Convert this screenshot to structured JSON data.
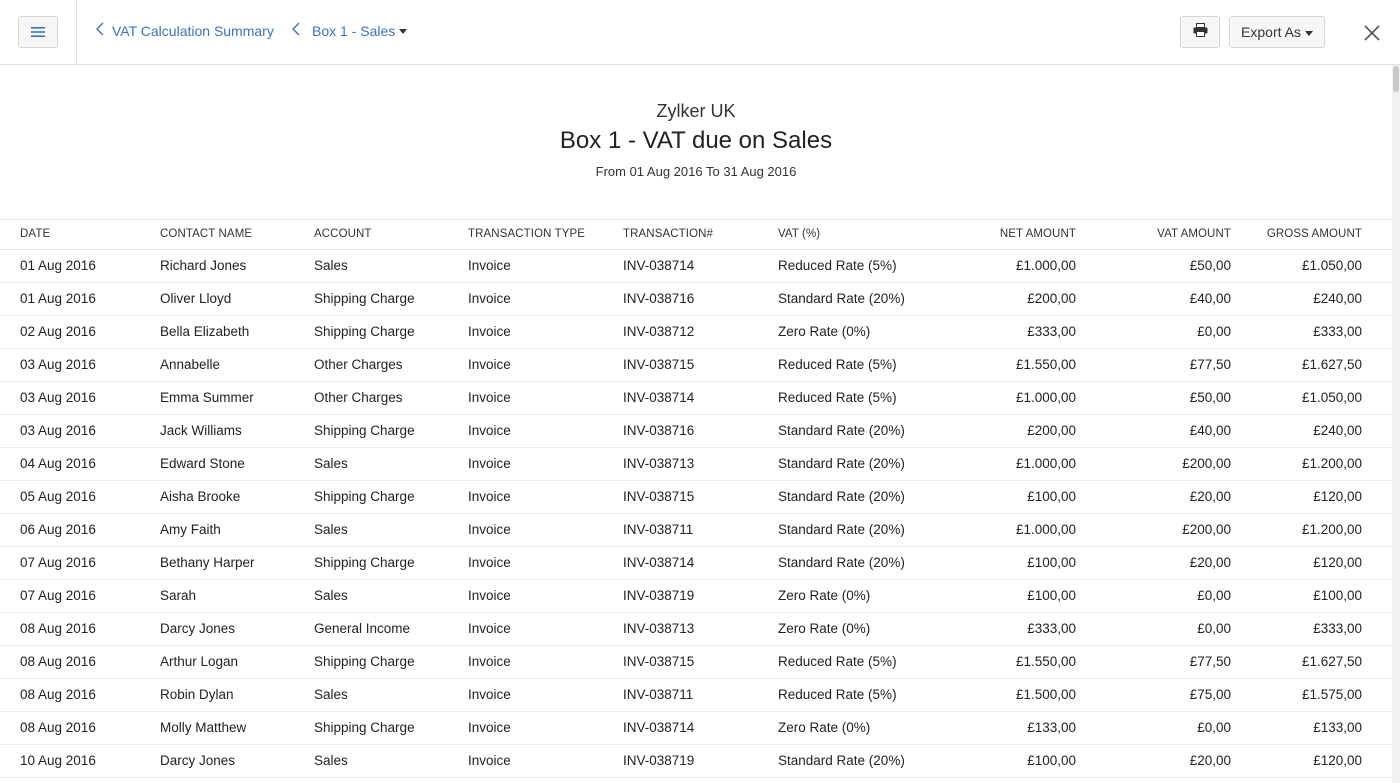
{
  "header": {
    "breadcrumb_parent": "VAT Calculation Summary",
    "breadcrumb_current": "Box 1 - Sales",
    "export_label": "Export As",
    "icons": [
      "menu-icon",
      "chevron-left-icon",
      "caret-down-icon",
      "printer-icon",
      "close-icon"
    ]
  },
  "report": {
    "organization": "Zylker UK",
    "title": "Box 1 - VAT due on Sales",
    "date_range": "From 01 Aug 2016 To 31 Aug 2016"
  },
  "table": {
    "columns": [
      "DATE",
      "CONTACT NAME",
      "ACCOUNT",
      "TRANSACTION TYPE",
      "TRANSACTION#",
      "VAT (%)",
      "NET AMOUNT",
      "VAT AMOUNT",
      "GROSS AMOUNT"
    ],
    "rows": [
      [
        "01 Aug 2016",
        "Richard Jones",
        "Sales",
        "Invoice",
        "INV-038714",
        "Reduced Rate (5%)",
        "£1.000,00",
        "£50,00",
        "£1.050,00"
      ],
      [
        "01 Aug 2016",
        "Oliver Lloyd",
        "Shipping Charge",
        "Invoice",
        "INV-038716",
        "Standard Rate (20%)",
        "£200,00",
        "£40,00",
        "£240,00"
      ],
      [
        "02 Aug 2016",
        "Bella Elizabeth",
        "Shipping Charge",
        "Invoice",
        "INV-038712",
        "Zero Rate (0%)",
        "£333,00",
        "£0,00",
        "£333,00"
      ],
      [
        "03 Aug 2016",
        "Annabelle",
        "Other Charges",
        "Invoice",
        "INV-038715",
        "Reduced Rate (5%)",
        "£1.550,00",
        "£77,50",
        "£1.627,50"
      ],
      [
        "03 Aug 2016",
        "Emma Summer",
        "Other Charges",
        "Invoice",
        "INV-038714",
        "Reduced Rate (5%)",
        "£1.000,00",
        "£50,00",
        "£1.050,00"
      ],
      [
        "03 Aug 2016",
        "Jack Williams",
        "Shipping Charge",
        "Invoice",
        "INV-038716",
        "Standard Rate (20%)",
        "£200,00",
        "£40,00",
        "£240,00"
      ],
      [
        "04 Aug 2016",
        "Edward Stone",
        "Sales",
        "Invoice",
        "INV-038713",
        "Standard Rate (20%)",
        "£1.000,00",
        "£200,00",
        "£1.200,00"
      ],
      [
        "05 Aug 2016",
        "Aisha Brooke",
        "Shipping Charge",
        "Invoice",
        "INV-038715",
        "Standard Rate (20%)",
        "£100,00",
        "£20,00",
        "£120,00"
      ],
      [
        "06 Aug 2016",
        "Amy Faith",
        "Sales",
        "Invoice",
        "INV-038711",
        "Standard Rate (20%)",
        "£1.000,00",
        "£200,00",
        "£1.200,00"
      ],
      [
        "07 Aug 2016",
        "Bethany Harper",
        "Shipping Charge",
        "Invoice",
        "INV-038714",
        "Standard Rate (20%)",
        "£100,00",
        "£20,00",
        "£120,00"
      ],
      [
        "07 Aug 2016",
        "Sarah",
        "Sales",
        "Invoice",
        "INV-038719",
        "Zero Rate (0%)",
        "£100,00",
        "£0,00",
        "£100,00"
      ],
      [
        "08 Aug 2016",
        "Darcy Jones",
        "General Income",
        "Invoice",
        "INV-038713",
        "Zero Rate (0%)",
        "£333,00",
        "£0,00",
        "£333,00"
      ],
      [
        "08 Aug 2016",
        "Arthur Logan",
        "Shipping Charge",
        "Invoice",
        "INV-038715",
        "Reduced Rate (5%)",
        "£1.550,00",
        "£77,50",
        "£1.627,50"
      ],
      [
        "08 Aug 2016",
        "Robin Dylan",
        "Sales",
        "Invoice",
        "INV-038711",
        "Reduced Rate (5%)",
        "£1.500,00",
        "£75,00",
        "£1.575,00"
      ],
      [
        "08 Aug 2016",
        "Molly Matthew",
        "Shipping Charge",
        "Invoice",
        "INV-038714",
        "Zero Rate (0%)",
        "£133,00",
        "£0,00",
        "£133,00"
      ],
      [
        "10 Aug 2016",
        "Darcy Jones",
        "Sales",
        "Invoice",
        "INV-038719",
        "Standard Rate (20%)",
        "£100,00",
        "£20,00",
        "£120,00"
      ]
    ]
  },
  "colors": {
    "link": "#3d73b8",
    "border": "#e4e4e4",
    "text": "#212121"
  }
}
